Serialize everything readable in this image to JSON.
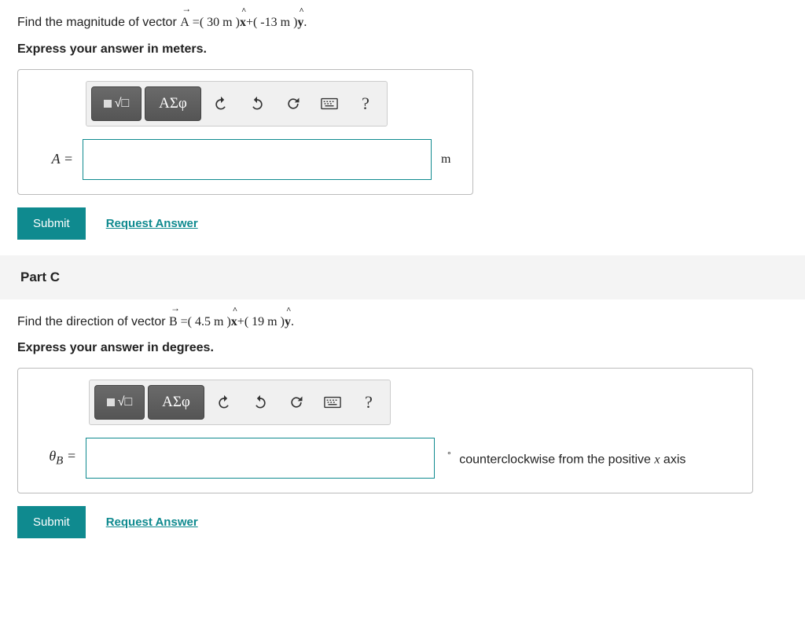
{
  "partB": {
    "question_prefix": "Find the magnitude of vector ",
    "vector_letter": "A",
    "eq_open": " =( ",
    "x_val": "30",
    "unit_m": " m ",
    "mid": ")x̂+( ",
    "y_val": "-13",
    "eq_close": ")ŷ.",
    "instruct": "Express your answer in meters.",
    "var_label": "A =",
    "unit_after": "m"
  },
  "toolbar": {
    "greek": "ΑΣφ",
    "help": "?"
  },
  "actions": {
    "submit": "Submit",
    "request": "Request Answer"
  },
  "partC": {
    "header": "Part C",
    "question_prefix": "Find the direction of vector ",
    "vector_letter": "B",
    "eq_open": " =( ",
    "x_val": "4.5",
    "unit_m": " m ",
    "mid": ")x̂+( ",
    "y_val": "19",
    "eq_close": ")ŷ.",
    "instruct": "Express your answer in degrees.",
    "var_label_html": "θB =",
    "deg_symbol": "°",
    "after_text_1": " counterclockwise from the positive ",
    "axis_var": "x",
    "after_text_2": " axis"
  }
}
